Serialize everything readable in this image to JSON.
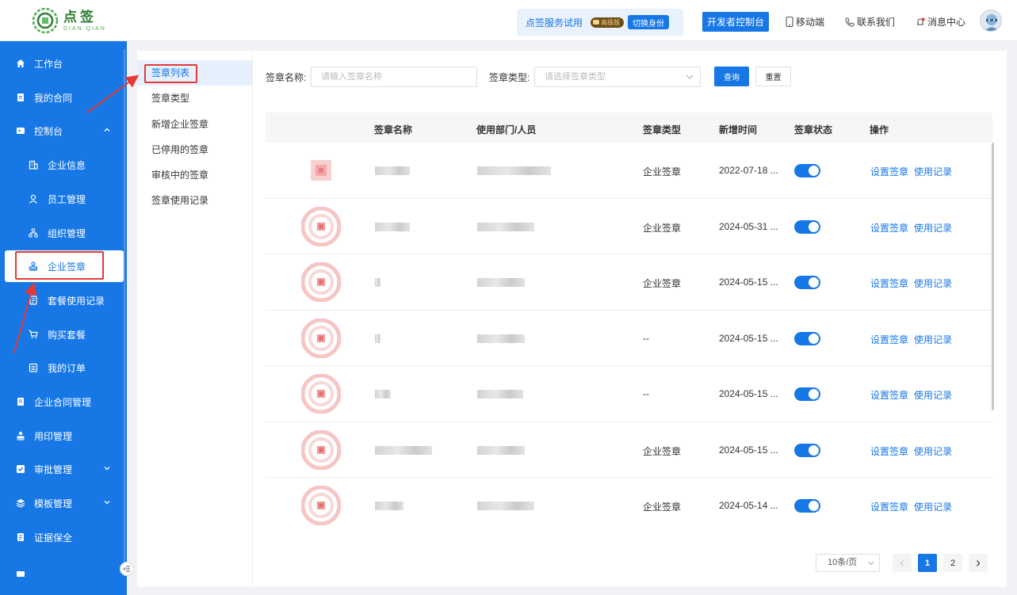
{
  "brand": {
    "name_cn": "点签",
    "name_en": "DIAN QIAN"
  },
  "header": {
    "trial_text": "点签服务试用",
    "vip_badge": "高级版",
    "switch_identity": "切换身份",
    "developer_console": "开发者控制台",
    "mobile": "移动端",
    "contact": "联系我们",
    "messages": "消息中心"
  },
  "sidebar": {
    "items": [
      {
        "label": "工作台"
      },
      {
        "label": "我的合同"
      },
      {
        "label": "控制台"
      },
      {
        "label": "企业信息"
      },
      {
        "label": "员工管理"
      },
      {
        "label": "组织管理"
      },
      {
        "label": "企业签章"
      },
      {
        "label": "套餐使用记录"
      },
      {
        "label": "购买套餐"
      },
      {
        "label": "我的订单"
      },
      {
        "label": "企业合同管理"
      },
      {
        "label": "用印管理"
      },
      {
        "label": "审批管理"
      },
      {
        "label": "模板管理"
      },
      {
        "label": "证据保全"
      }
    ]
  },
  "subnav": {
    "items": [
      {
        "label": "签章列表"
      },
      {
        "label": "签章类型"
      },
      {
        "label": "新增企业签章"
      },
      {
        "label": "已停用的签章"
      },
      {
        "label": "审核中的签章"
      },
      {
        "label": "签章使用记录"
      }
    ]
  },
  "filters": {
    "name_label": "签章名称:",
    "name_placeholder": "请输入签章名称",
    "type_label": "签章类型:",
    "type_placeholder": "请选择签章类型",
    "query_button": "查询",
    "reset_button": "重置"
  },
  "table": {
    "headers": [
      "签章名称",
      "使用部门/人员",
      "签章类型",
      "新增时间",
      "签章状态",
      "操作"
    ],
    "rows": [
      {
        "type": "企业签章",
        "date": "2022-07-18 ...",
        "enabled": true
      },
      {
        "type": "企业签章",
        "date": "2024-05-31 ...",
        "enabled": true
      },
      {
        "type": "企业签章",
        "date": "2024-05-15 ...",
        "enabled": true
      },
      {
        "type": "--",
        "date": "2024-05-15 ...",
        "enabled": true
      },
      {
        "type": "--",
        "date": "2024-05-15 ...",
        "enabled": true
      },
      {
        "type": "企业签章",
        "date": "2024-05-15 ...",
        "enabled": true
      },
      {
        "type": "企业签章",
        "date": "2024-05-14 ...",
        "enabled": true
      }
    ],
    "action_settings": "设置签章",
    "action_usage": "使用记录"
  },
  "pagination": {
    "page_size": "10条/页",
    "pages": [
      "1",
      "2"
    ],
    "current": "1"
  },
  "icons": {
    "sidebar": [
      "home-icon",
      "contract-icon",
      "console-icon",
      "building-icon",
      "user-icon",
      "org-icon",
      "stamp-icon",
      "record-icon",
      "cart-icon",
      "order-icon",
      "doc-icon",
      "seal-icon",
      "check-icon",
      "template-icon",
      "evidence-icon"
    ]
  },
  "colors": {
    "primary": "#1677e5",
    "annotation": "#e53935"
  }
}
